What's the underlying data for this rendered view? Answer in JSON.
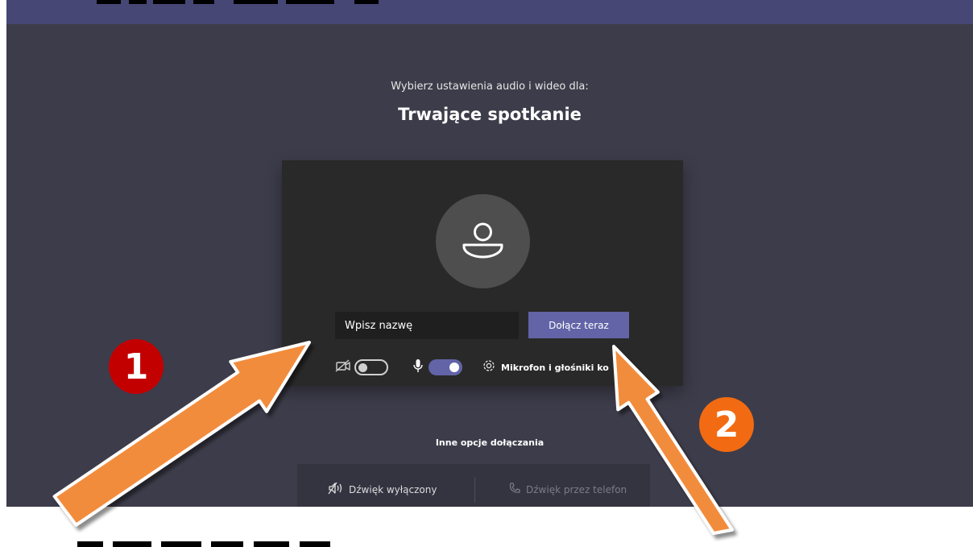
{
  "prejoin": {
    "subtitle": "Wybierz ustawienia audio i wideo dla:",
    "title": "Trwające spotkanie",
    "name_placeholder": "Wpisz nazwę",
    "join_label": "Dołącz teraz",
    "devices_label": "Mikrofon i głośniki ko",
    "camera_toggle": "off",
    "mic_toggle": "on"
  },
  "other_options": {
    "title": "Inne opcje dołączania",
    "audio_off_label": "Dźwięk wyłączony",
    "phone_label": "Dźwięk przez telefon"
  },
  "annotations": {
    "marker_1": "1",
    "marker_2": "2"
  },
  "colors": {
    "accent": "#6264a7",
    "background": "#3d3c4a",
    "panel": "#292929",
    "marker_1": "#c30000",
    "marker_2": "#f26b12",
    "arrow": "#f28c3c"
  },
  "icons": [
    "user-avatar-icon",
    "camera-off-icon",
    "microphone-icon",
    "gear-icon",
    "speaker-off-icon",
    "phone-icon"
  ]
}
